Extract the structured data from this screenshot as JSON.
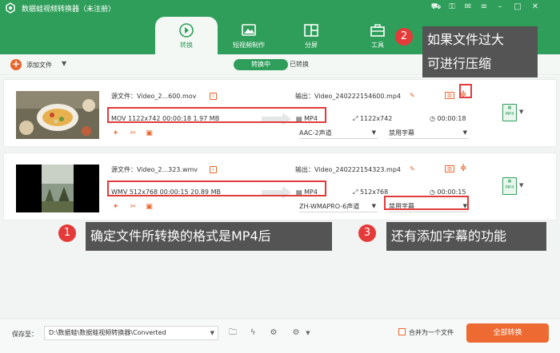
{
  "titlebar": {
    "title": "数据蛙视频转换器（未注册）"
  },
  "nav": {
    "tabs": [
      {
        "label": "转换",
        "active": true
      },
      {
        "label": "短视频制作",
        "active": false
      },
      {
        "label": "分屏",
        "active": false
      },
      {
        "label": "工具",
        "active": false
      }
    ]
  },
  "toolbar": {
    "add_file": "添加文件",
    "seg_converting": "转换中",
    "seg_done": "已转换"
  },
  "items": [
    {
      "source": "源文件：Video_2...600.mov",
      "src_info": "MOV   1122x742   00:00:18   1.97 MB",
      "output": "输出：Video_240222154600.mp4",
      "format": "MP4",
      "resolution": "1122x742",
      "duration": "00:00:18",
      "audio": "AAC-2声道",
      "subtitle": "禁用字幕",
      "badge": "MP4"
    },
    {
      "source": "源文件：Video_2...323.wmv",
      "src_info": "WMV   512x768   00:00:15   20.89 MB",
      "output": "输出：Video_240222154323.mp4",
      "format": "MP4",
      "resolution": "512x768",
      "duration": "00:00:15",
      "audio": "ZH-WMAPRO-6声道",
      "subtitle": "禁用字幕",
      "badge": "MP4"
    }
  ],
  "annotations": {
    "n1": "1",
    "t1": "确定文件所转换的格式是MP4后",
    "n2": "2",
    "t2a": "如果文件过大",
    "t2b": "可进行压缩",
    "n3": "3",
    "t3": "还有添加字幕的功能"
  },
  "footer": {
    "save_label": "保存至：",
    "path": "D:\\数据蛙\\数据蛙视频转换器\\Converted",
    "merge_label": "合并为一个文件",
    "convert_all": "全部转换"
  },
  "colors": {
    "brand": "#2f9e5a",
    "accent": "#ed6a32",
    "annotation_red": "#e23b3b"
  }
}
